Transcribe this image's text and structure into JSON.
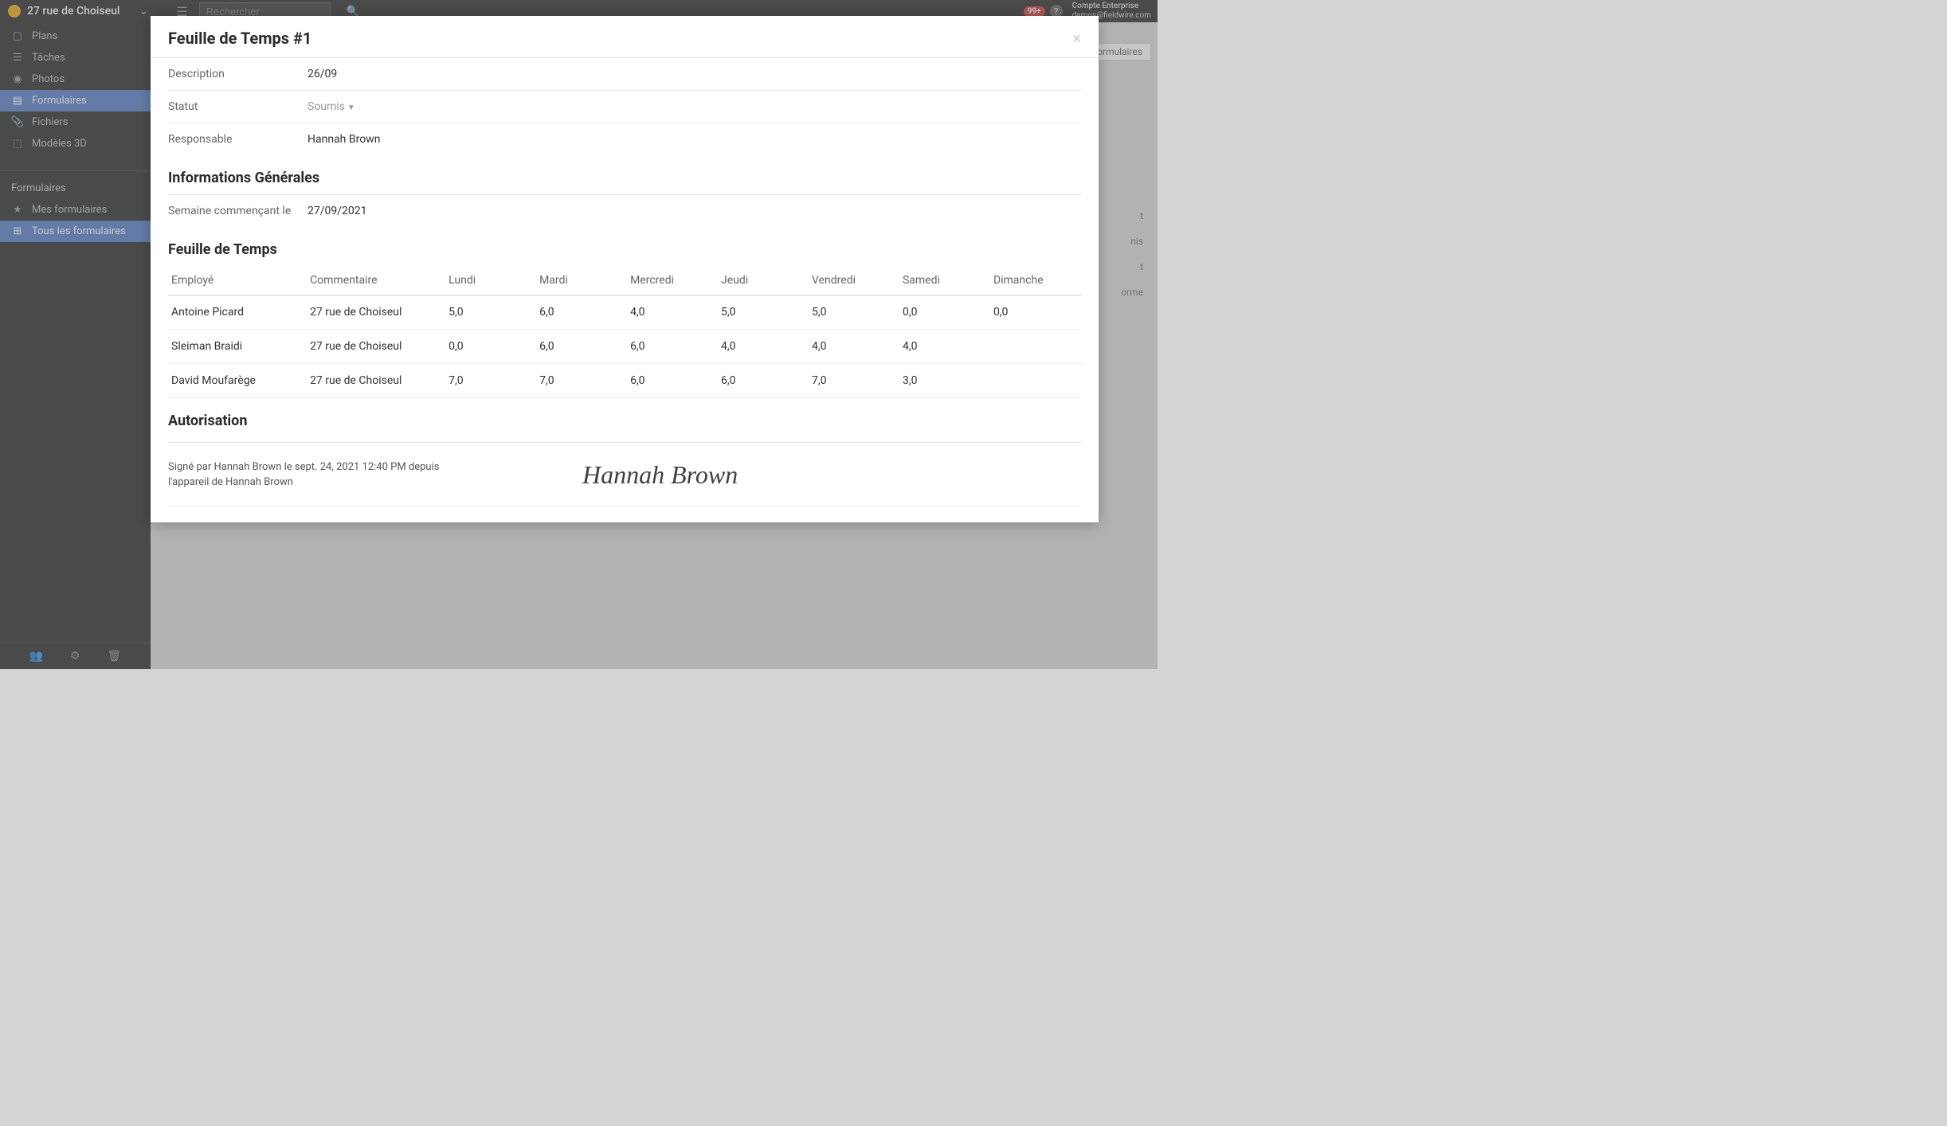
{
  "topbar": {
    "project_name": "27 rue de Choiseul",
    "search_placeholder": "Rechercher",
    "notification_badge": "99+",
    "account_line1": "Compte Enterprise",
    "account_line2": "demos@fieldwire.com"
  },
  "sidebar": {
    "items": [
      {
        "label": "Plans",
        "icon": "▢"
      },
      {
        "label": "Tâches",
        "icon": "≡"
      },
      {
        "label": "Photos",
        "icon": "📷"
      },
      {
        "label": "Formulaires",
        "icon": "▤"
      },
      {
        "label": "Fichiers",
        "icon": "📎"
      },
      {
        "label": "Modèles 3D",
        "icon": "⬚"
      }
    ],
    "sub_heading": "Formulaires",
    "sub_items": [
      {
        "label": "Mes formulaires",
        "icon": "★"
      },
      {
        "label": "Tous les formulaires",
        "icon": "⊞"
      }
    ]
  },
  "behind": {
    "btn1": "formulaires",
    "row1": "t",
    "row2": "nis",
    "row3": "t",
    "row4": "orme"
  },
  "modal": {
    "title": "Feuille de Temps #1",
    "fields": {
      "description_label": "Description",
      "description_value": "26/09",
      "statut_label": "Statut",
      "statut_value": "Soumis",
      "responsable_label": "Responsable",
      "responsable_value": "Hannah Brown"
    },
    "section_info_title": "Informations Générales",
    "week_label": "Semaine commençant le",
    "week_value": "27/09/2021",
    "section_timesheet_title": "Feuille de Temps",
    "table": {
      "headers": {
        "employe": "Employé",
        "commentaire": "Commentaire",
        "lundi": "Lundi",
        "mardi": "Mardi",
        "mercredi": "Mercredi",
        "jeudi": "Jeudi",
        "vendredi": "Vendredi",
        "samedi": "Samedi",
        "dimanche": "Dimanche"
      },
      "rows": [
        {
          "employe": "Antoine Picard",
          "commentaire": "27 rue de Choiseul",
          "lundi": "5,0",
          "mardi": "6,0",
          "mercredi": "4,0",
          "jeudi": "5,0",
          "vendredi": "5,0",
          "samedi": "0,0",
          "dimanche": "0,0"
        },
        {
          "employe": "Sleiman Braidi",
          "commentaire": "27 rue de Choiseul",
          "lundi": "0,0",
          "mardi": "6,0",
          "mercredi": "6,0",
          "jeudi": "4,0",
          "vendredi": "4,0",
          "samedi": "4,0",
          "dimanche": ""
        },
        {
          "employe": "David Moufarège",
          "commentaire": "27 rue de Choiseul",
          "lundi": "7,0",
          "mardi": "7,0",
          "mercredi": "6,0",
          "jeudi": "6,0",
          "vendredi": "7,0",
          "samedi": "3,0",
          "dimanche": ""
        }
      ]
    },
    "section_auth_title": "Autorisation",
    "signature_text": "Signé par Hannah Brown le sept. 24, 2021 12:40 PM depuis l'appareil de Hannah Brown",
    "signature_name": "Hannah Brown"
  }
}
